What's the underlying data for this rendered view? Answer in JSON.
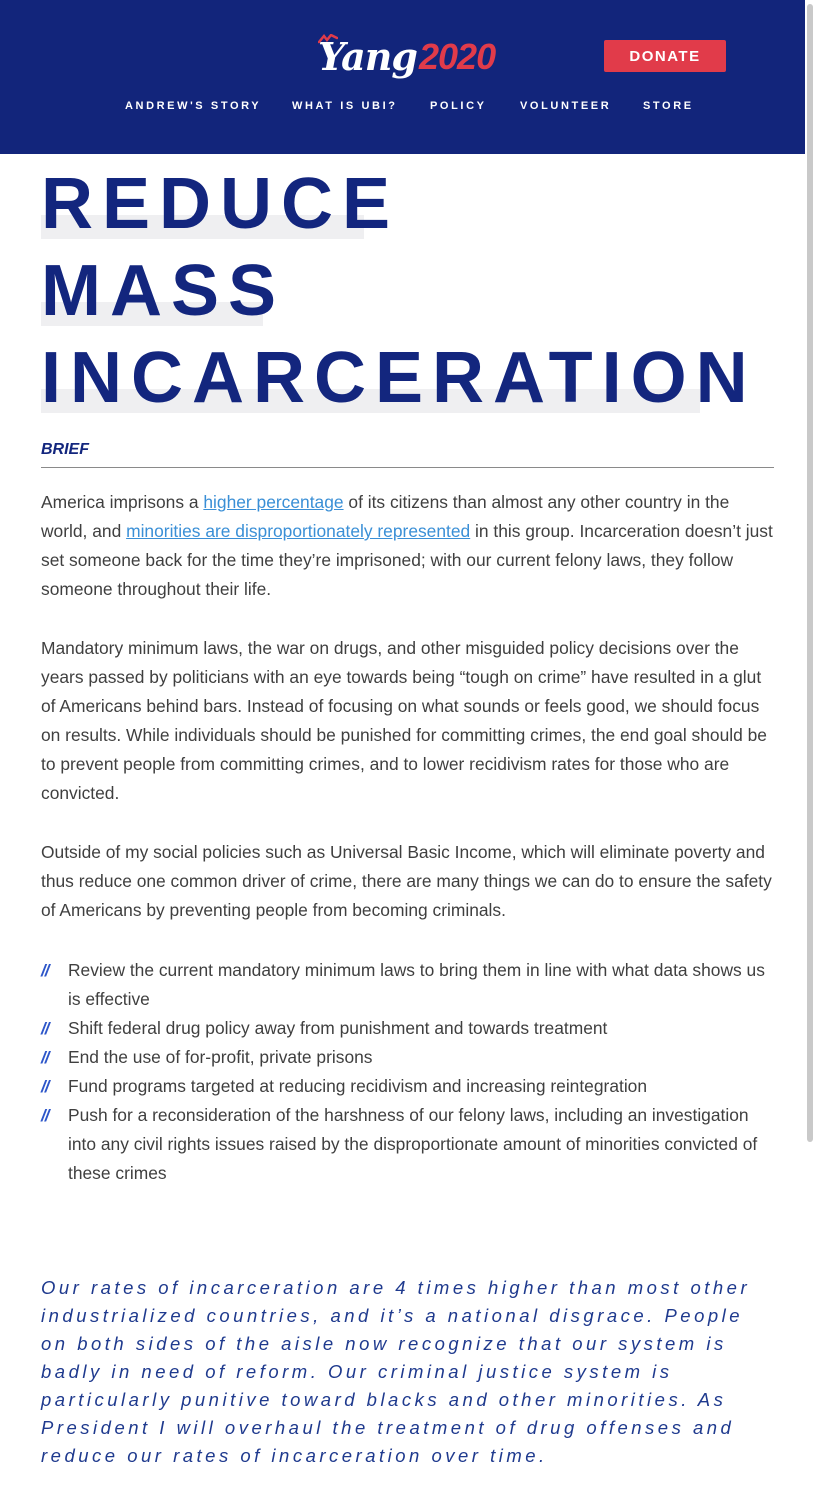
{
  "header": {
    "logo_text": "Yang",
    "logo_year": "2020",
    "donate_label": "DONATE",
    "nav": [
      "ANDREW'S STORY",
      "WHAT IS UBI?",
      "POLICY",
      "VOLUNTEER",
      "STORE"
    ]
  },
  "title_lines": [
    "REDUCE",
    "MASS",
    "INCARCERATION"
  ],
  "brief_label": "BRIEF",
  "para1": {
    "t1": "America imprisons a ",
    "link1": "higher percentage",
    "t2": " of its citizens than almost any other country in the world, and ",
    "link2": "minorities are disproportionately represented",
    "t3": " in this group. Incarceration doesn’t just set someone back for the time they’re imprisoned; with our current felony laws, they follow someone throughout their life."
  },
  "para2": "Mandatory minimum laws, the war on drugs, and other misguided policy decisions over the years passed by politicians with an eye towards being “tough on crime” have resulted in a glut of Americans behind bars. Instead of focusing on what sounds or feels good, we should focus on results. While individuals should be punished for committing crimes, the end goal should be to prevent people from committing crimes, and to lower recidivism rates for those who are convicted.",
  "para3": "Outside of my social policies such as Universal Basic Income, which will eliminate poverty and thus reduce one common driver of crime, there are many things we can do to ensure the safety of Americans by preventing people from becoming criminals.",
  "bullet_mark": "//",
  "bullets": [
    "Review the current mandatory minimum laws to bring them in line with what data shows us is effective",
    "Shift federal drug policy away from punishment and towards treatment",
    "End the use of for-profit, private prisons",
    "Fund programs targeted at reducing recidivism and increasing reintegration",
    "Push for a reconsideration of the harshness of our felony laws, including an investigation into any civil rights issues raised by the disproportionate amount of minorities convicted of these crimes"
  ],
  "quote": "Our rates of incarceration are 4 times higher than most other industrialized countries, and it’s a national disgrace. People on both sides of the aisle now recognize that our system is badly in need of reform. Our criminal justice system is particularly punitive toward blacks and other minorities. As President I will overhaul the treatment of drug offenses and reduce our rates of incarceration over time.",
  "colors": {
    "header_bg": "#12257b",
    "brand_red": "#e13b4a",
    "title_blue": "#13267e",
    "link_blue": "#3a8fd6"
  }
}
